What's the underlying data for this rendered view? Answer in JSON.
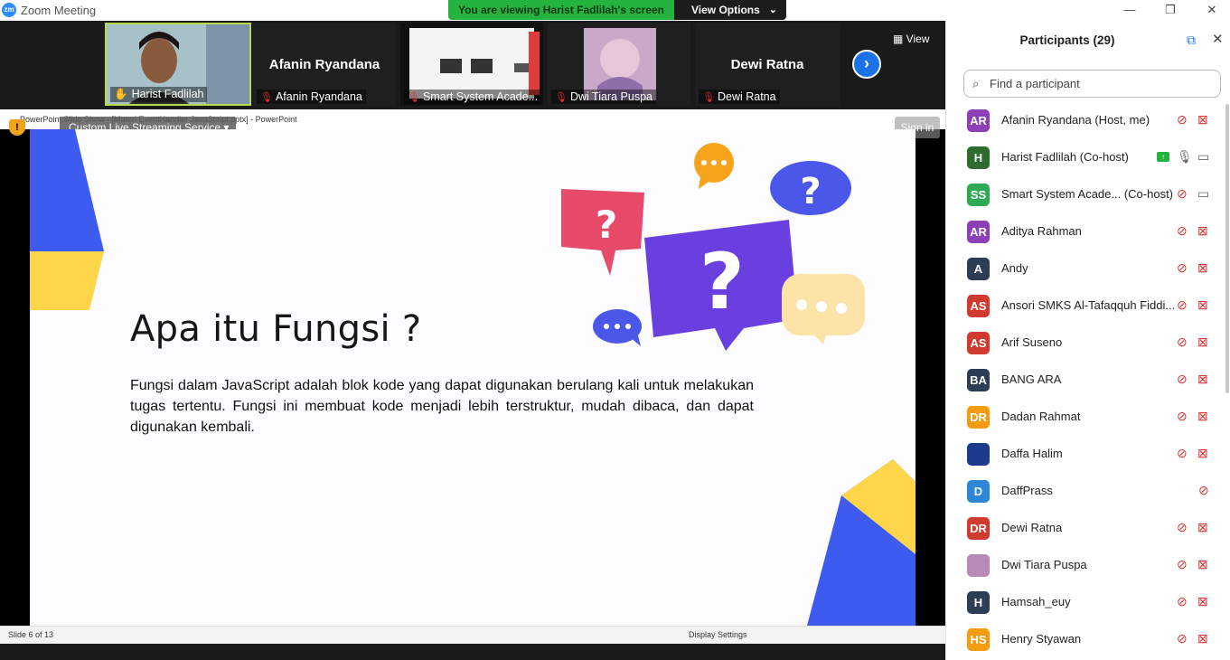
{
  "window": {
    "title": "Zoom Meeting",
    "logo": "zm",
    "banner": "You are viewing Harist Fadlilah's screen",
    "view_options": "View Options",
    "controls": [
      "—",
      "❐",
      "✕"
    ]
  },
  "strip": {
    "tiles": [
      {
        "name": "Harist Fadlilah",
        "big": ""
      },
      {
        "name": "Afanin Ryandana",
        "big": "Afanin Ryandana"
      },
      {
        "name": "Smart System Acade...",
        "big": ""
      },
      {
        "name": "Dwi Tiara Puspa",
        "big": ""
      },
      {
        "name": "Dewi Ratna",
        "big": "Dewi Ratna"
      }
    ],
    "view_label": "View",
    "next_icon": "chevron-right-icon"
  },
  "share": {
    "ppt_title": "PowerPoint Slide Show - [Materi EventHandler JavaScript.pptx] - PowerPoint",
    "stream_label": "Custom Live Streaming Service",
    "sign_in": "Sign in",
    "slide_title": "Apa itu Fungsi ?",
    "slide_body": "Fungsi dalam JavaScript adalah blok kode yang dapat digunakan berulang kali untuk melakukan tugas tertentu. Fungsi ini membuat kode menjadi lebih terstruktur, mudah dibaca, dan dapat digunakan kembali.",
    "slide_number": "Slide 6 of 13",
    "display_settings": "Display Settings",
    "colors": {
      "blue": "#3e5bf0",
      "yellow": "#ffd54a",
      "purple": "#6a3fe0",
      "pink": "#e84a6a",
      "orange": "#f7a41c",
      "cream": "#fce3a8"
    }
  },
  "panel": {
    "title": "Participants (29)",
    "search_placeholder": "Find a participant",
    "participants": [
      {
        "initials": "AR",
        "name": "Afanin Ryandana (Host, me)",
        "color": "#8e3fb7",
        "mic": "muted",
        "cam": "off"
      },
      {
        "initials": "H",
        "name": "Harist Fadlilah (Co-host)",
        "color": "#2e6b2e",
        "mic": "on",
        "cam": "on",
        "sharing": true
      },
      {
        "initials": "SS",
        "name": "Smart System Acade...   (Co-host)",
        "color": "#2eaa55",
        "mic": "muted",
        "cam": "on"
      },
      {
        "initials": "AR",
        "name": "Aditya Rahman",
        "color": "#8e3fb7",
        "mic": "muted",
        "cam": "off"
      },
      {
        "initials": "A",
        "name": "Andy",
        "color": "#2c3e55",
        "mic": "muted",
        "cam": "off"
      },
      {
        "initials": "AS",
        "name": "Ansori SMKS Al-Tafaqquh Fiddi...",
        "color": "#d03a2f",
        "mic": "muted",
        "cam": "off"
      },
      {
        "initials": "AS",
        "name": "Arif Suseno",
        "color": "#d03a2f",
        "mic": "muted",
        "cam": "off"
      },
      {
        "initials": "BA",
        "name": "BANG ARA",
        "color": "#2c3e55",
        "mic": "muted",
        "cam": "off"
      },
      {
        "initials": "DR",
        "name": "Dadan Rahmat",
        "color": "#f39c12",
        "mic": "muted",
        "cam": "off"
      },
      {
        "initials": "",
        "name": "Daffa Halim",
        "color": "#1b3a8c",
        "mic": "muted",
        "cam": "off"
      },
      {
        "initials": "D",
        "name": "DaffPrass",
        "color": "#2d86d6",
        "mic": "muted",
        "cam": ""
      },
      {
        "initials": "DR",
        "name": "Dewi Ratna",
        "color": "#d03a2f",
        "mic": "muted",
        "cam": "off"
      },
      {
        "initials": "",
        "name": "Dwi Tiara Puspa",
        "color": "#b98ab8",
        "mic": "muted",
        "cam": "off"
      },
      {
        "initials": "H",
        "name": "Hamsah_euy",
        "color": "#2c3e55",
        "mic": "muted",
        "cam": "off"
      },
      {
        "initials": "HS",
        "name": "Henry Styawan",
        "color": "#f39c12",
        "mic": "muted",
        "cam": "off"
      }
    ]
  }
}
